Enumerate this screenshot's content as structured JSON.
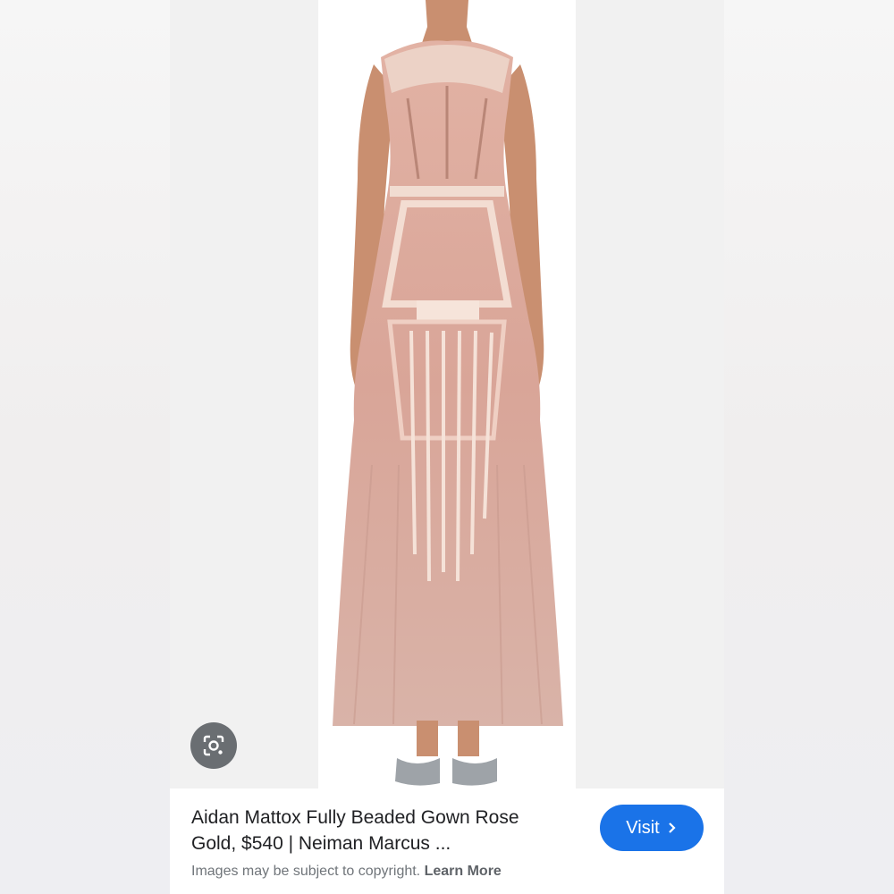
{
  "result": {
    "title": "Aidan Mattox Fully Beaded Gown Rose Gold, $540 | Neiman Marcus ...",
    "visit_label": "Visit",
    "copyright_text": "Images may be subject to copyright.",
    "learn_more_label": "Learn More"
  },
  "icons": {
    "lens": "lens-camera-icon",
    "visit_chevron": "chevron-right-icon"
  },
  "colors": {
    "accent": "#1a73e8",
    "gown": "#d9a79a",
    "sequin": "#f3ddd2",
    "skin": "#c98f70",
    "tulle": "#d7b1a6"
  }
}
